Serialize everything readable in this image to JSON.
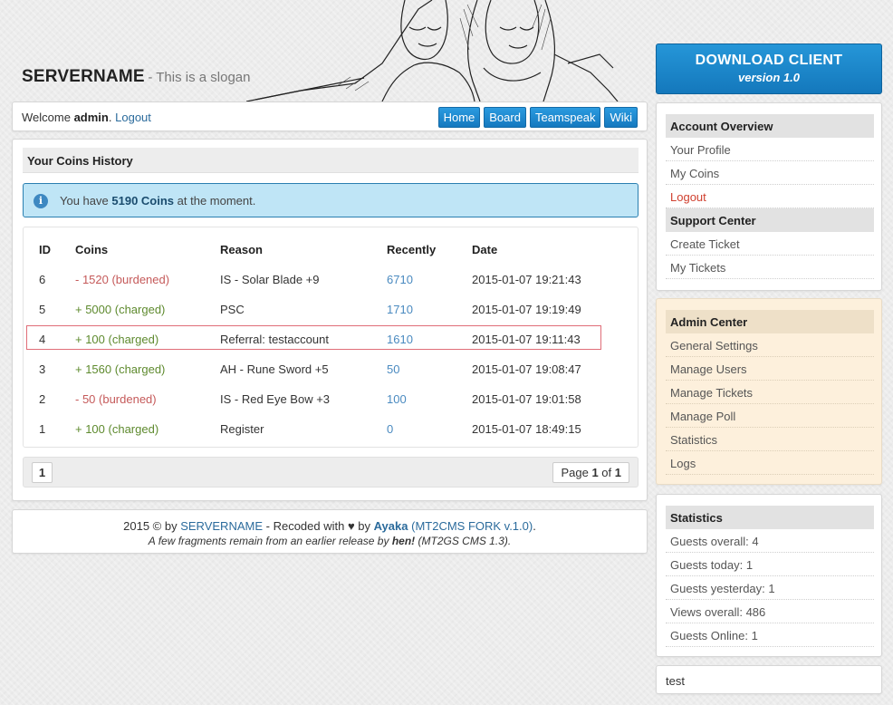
{
  "brand": {
    "name": "SERVERNAME",
    "slogan": "- This is a slogan"
  },
  "topbar": {
    "welcome_prefix": "Welcome",
    "username": "admin",
    "welcome_suffix": ".",
    "logout": "Logout",
    "nav": [
      "Home",
      "Board",
      "Teamspeak",
      "Wiki"
    ]
  },
  "main": {
    "title": "Your Coins History",
    "alert": {
      "prefix": "You have",
      "coins": "5190 Coins",
      "suffix": "at the moment."
    },
    "table": {
      "headers": [
        "ID",
        "Coins",
        "Reason",
        "Recently",
        "Date"
      ],
      "rows": [
        {
          "id": "6",
          "coins": "- 1520 (burdened)",
          "reason": "IS - Solar Blade +9",
          "recently": "6710",
          "date": "2015-01-07 19:21:43"
        },
        {
          "id": "5",
          "coins": "+ 5000 (charged)",
          "reason": "PSC",
          "recently": "1710",
          "date": "2015-01-07 19:19:49"
        },
        {
          "id": "4",
          "coins": "+ 100 (charged)",
          "reason": "Referral: testaccount",
          "recently": "1610",
          "date": "2015-01-07 19:11:43"
        },
        {
          "id": "3",
          "coins": "+ 1560 (charged)",
          "reason": "AH - Rune Sword +5",
          "recently": "50",
          "date": "2015-01-07 19:08:47"
        },
        {
          "id": "2",
          "coins": "- 50 (burdened)",
          "reason": "IS - Red Eye Bow +3",
          "recently": "100",
          "date": "2015-01-07 19:01:58"
        },
        {
          "id": "1",
          "coins": "+ 100 (charged)",
          "reason": "Register",
          "recently": "0",
          "date": "2015-01-07 18:49:15"
        }
      ]
    },
    "pager": {
      "current": "1",
      "label": "Page",
      "page": "1",
      "of": "of",
      "total": "1"
    }
  },
  "footer": {
    "line1_a": "2015 © by",
    "line1_server": "SERVERNAME",
    "line1_b": "- Recoded with ♥ by",
    "line1_author": "Ayaka",
    "line1_fork": "(MT2CMS FORK v.1.0)",
    "line1_end": ".",
    "line2_a": "A few fragments remain from an earlier release by",
    "line2_author": "hen!",
    "line2_b": "(MT2GS CMS 1.3)."
  },
  "download": {
    "title": "DOWNLOAD CLIENT",
    "version": "version 1.0"
  },
  "sidebar": {
    "account": {
      "title": "Account Overview",
      "items": [
        "Your Profile",
        "My Coins",
        "Logout"
      ]
    },
    "support": {
      "title": "Support Center",
      "items": [
        "Create Ticket",
        "My Tickets"
      ]
    },
    "admin": {
      "title": "Admin Center",
      "items": [
        "General Settings",
        "Manage Users",
        "Manage Tickets",
        "Manage Poll",
        "Statistics",
        "Logs"
      ]
    },
    "stats": {
      "title": "Statistics",
      "items": [
        "Guests overall: 4",
        "Guests today: 1",
        "Guests yesterday: 1",
        "Views overall: 486",
        "Guests Online: 1"
      ]
    },
    "test": "test"
  }
}
